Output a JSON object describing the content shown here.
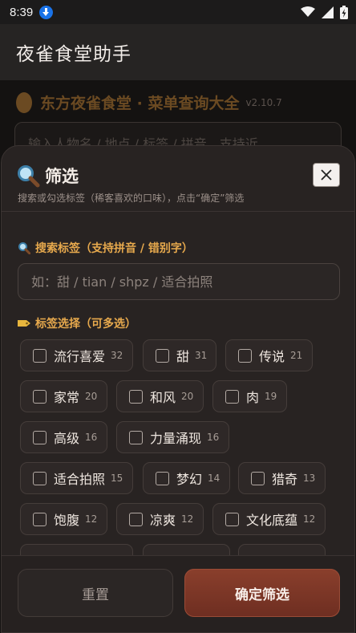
{
  "status": {
    "time": "8:39"
  },
  "app": {
    "title": "夜雀食堂助手"
  },
  "behind": {
    "title": "东方夜雀食堂 · 菜单查询大全",
    "version": "v2.10.7",
    "search_placeholder": "输入人物名 / 地点 / 标签 / 拼音，支持近"
  },
  "sheet": {
    "title": "筛选",
    "subtitle": "搜索或勾选标签（稀客喜欢的口味），点击“确定”筛选",
    "close_label": "×",
    "search_section": "搜索标签（支持拼音 / 错别字）",
    "search_placeholder": "如：甜 / tian / shpz / 适合拍照",
    "search_value": "",
    "tag_section": "标签选择（可多选）",
    "tags": [
      {
        "name": "流行喜爱",
        "count": "32",
        "checked": false
      },
      {
        "name": "甜",
        "count": "31",
        "checked": false
      },
      {
        "name": "传说",
        "count": "21",
        "checked": false
      },
      {
        "name": "家常",
        "count": "20",
        "checked": false
      },
      {
        "name": "和风",
        "count": "20",
        "checked": false
      },
      {
        "name": "肉",
        "count": "19",
        "checked": false
      },
      {
        "name": "高级",
        "count": "16",
        "checked": false
      },
      {
        "name": "力量涌现",
        "count": "16",
        "checked": false
      },
      {
        "name": "适合拍照",
        "count": "15",
        "checked": false
      },
      {
        "name": "梦幻",
        "count": "14",
        "checked": false
      },
      {
        "name": "猎奇",
        "count": "13",
        "checked": false
      },
      {
        "name": "饱腹",
        "count": "12",
        "checked": false
      },
      {
        "name": "凉爽",
        "count": "12",
        "checked": false
      },
      {
        "name": "文化底蕴",
        "count": "12",
        "checked": false
      }
    ],
    "reset_label": "重置",
    "confirm_label": "确定筛选"
  },
  "colors": {
    "accent": "#e7a94d",
    "confirm": "#8a3f2c",
    "sheet_bg": "#282322"
  },
  "icons": [
    "download-icon",
    "wifi-icon",
    "signal-icon",
    "battery-icon",
    "magnifier-icon",
    "tag-icon",
    "close-icon"
  ]
}
